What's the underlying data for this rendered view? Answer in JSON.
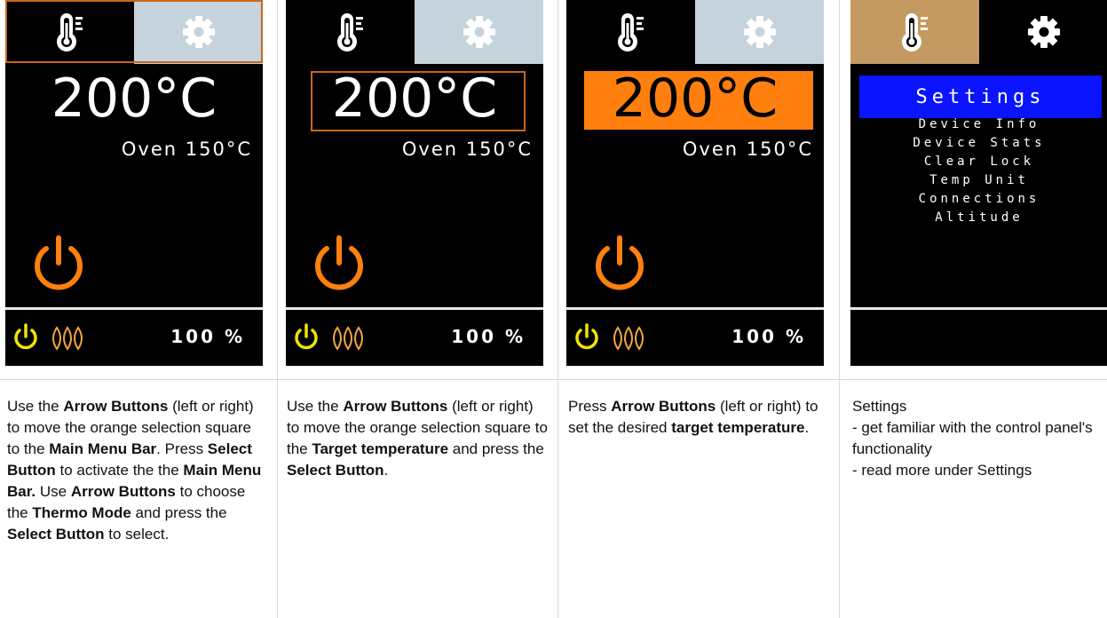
{
  "panels": [
    {
      "temperature": "200°C",
      "oven_label": "Oven 150°C",
      "percent": "100 %",
      "caption": [
        {
          "t": "Use the "
        },
        {
          "t": "Arrow Buttons",
          "b": true
        },
        {
          "t": " (left or right) to move the orange selection square to the "
        },
        {
          "t": "Main Menu Bar",
          "b": true
        },
        {
          "t": ". Press "
        },
        {
          "t": "Select Button",
          "b": true
        },
        {
          "t": " to activate the the "
        },
        {
          "t": "Main Menu Bar.",
          "b": true
        },
        {
          "t": " Use "
        },
        {
          "t": "Arrow Buttons",
          "b": true
        },
        {
          "t": " to choose the "
        },
        {
          "t": "Thermo Mode",
          "b": true
        },
        {
          "t": " and press the "
        },
        {
          "t": "Select Button",
          "b": true
        },
        {
          "t": " to select."
        }
      ]
    },
    {
      "temperature": "200°C",
      "oven_label": "Oven 150°C",
      "percent": "100 %",
      "caption": [
        {
          "t": "Use the "
        },
        {
          "t": "Arrow Buttons",
          "b": true
        },
        {
          "t": " (left or right) to move the orange selection square to the "
        },
        {
          "t": "Target temperature",
          "b": true
        },
        {
          "t": " and press the "
        },
        {
          "t": "Select Button",
          "b": true
        },
        {
          "t": "."
        }
      ]
    },
    {
      "temperature": "200°C",
      "oven_label": "Oven 150°C",
      "percent": "100 %",
      "caption": [
        {
          "t": "Press "
        },
        {
          "t": "Arrow Buttons",
          "b": true
        },
        {
          "t": " (left or right) to set the desired "
        },
        {
          "t": "target temperature",
          "b": true
        },
        {
          "t": "."
        }
      ]
    },
    {
      "menu_title": "Settings",
      "menu_items": [
        "Device Info",
        "Device Stats",
        "Clear Lock",
        "Temp Unit",
        "Connections",
        "Altitude"
      ],
      "caption_lines": [
        "Settings",
        "- get familiar with the control panel's functionality",
        "- read more under Settings"
      ]
    }
  ],
  "icons": {
    "thermo_tab": "thermometer-icon",
    "settings_tab": "gear-icon",
    "power_large": "power-icon",
    "power_small": "power-icon",
    "heat": "heating-elements-icon"
  },
  "colors": {
    "accent_orange": "#ff7f0f",
    "selection_border": "#c8661a",
    "tab_inactive": "#c5d3dc",
    "tab_active_tan": "#c49a62",
    "power_yellow": "#f0e400",
    "menu_blue": "#0a14ff"
  }
}
